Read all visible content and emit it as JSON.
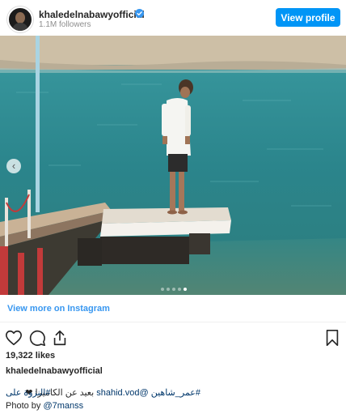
{
  "profile": {
    "username": "khaledelnabawyofficial",
    "followers": "1.1M followers",
    "view_profile_label": "View profile"
  },
  "media": {
    "carousel_prev_icon": "chevron-left-icon",
    "dots_total": 5,
    "dot_active_index": 4
  },
  "view_more_label": "View more on Instagram",
  "actions": [
    "heart-icon",
    "comment-icon",
    "share-icon",
    "bookmark-icon"
  ],
  "likes": "19,322 likes",
  "caption": {
    "username": "khaledelnabawyofficial",
    "line1_tag": "#عمر_شاهين",
    "line1_mention": "@shahid.vod",
    "line1_text": "بعيد عن الكاميرا ❤",
    "line2": "#النزوة على",
    "line3_prefix": "Photo by",
    "line3_mention": "@7manss"
  },
  "colors": {
    "accent": "#0095f6",
    "link": "#3897f0",
    "water": "#2f8f96",
    "sand": "#cfbfa5"
  }
}
